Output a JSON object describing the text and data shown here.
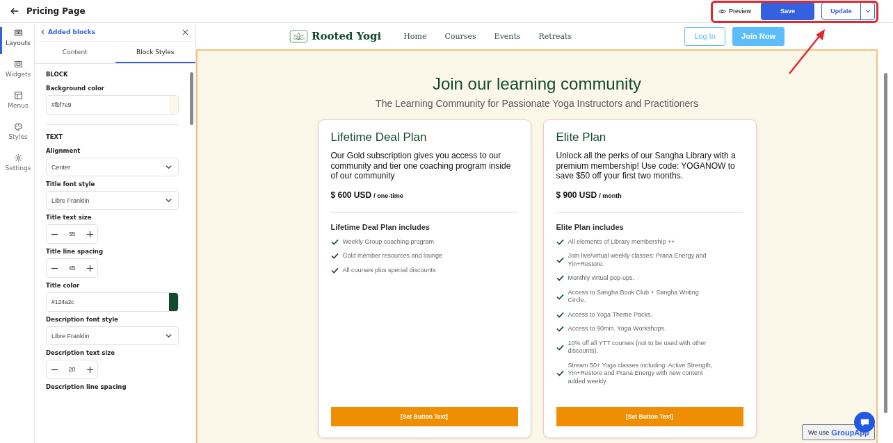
{
  "header": {
    "title": "Pricing Page",
    "preview": "Preview",
    "save": "Save",
    "update": "Update"
  },
  "rail": [
    {
      "label": "Layouts",
      "kind": "layouts",
      "selected": true
    },
    {
      "label": "Widgets",
      "kind": "widgets",
      "selected": false
    },
    {
      "label": "Menus",
      "kind": "menus",
      "selected": false
    },
    {
      "label": "Styles",
      "kind": "styles",
      "selected": false
    },
    {
      "label": "Settings",
      "kind": "settings",
      "selected": false
    }
  ],
  "panel": {
    "back": "Added blocks",
    "tabs": [
      {
        "label": "Content",
        "selected": false
      },
      {
        "label": "Block Styles",
        "selected": true
      }
    ],
    "sections": [
      {
        "title": "BLOCK",
        "fields": [
          {
            "kind": "color",
            "label": "Background color",
            "value": "#fbf7e9",
            "color": "#fbf7e9"
          }
        ]
      },
      {
        "title": "TEXT",
        "fields": [
          {
            "kind": "select",
            "label": "Alignment",
            "value": "Center"
          },
          {
            "kind": "select",
            "label": "Title font style",
            "value": "Libre Franklin"
          },
          {
            "kind": "stepper",
            "label": "Title text size",
            "value": "35"
          },
          {
            "kind": "stepper",
            "label": "Title line spacing",
            "value": "45"
          },
          {
            "kind": "color",
            "label": "Title color",
            "value": "#124a2c",
            "color": "#124a2c"
          },
          {
            "kind": "select",
            "label": "Description font style",
            "value": "Libre Franklin"
          },
          {
            "kind": "stepper",
            "label": "Description text size",
            "value": "20"
          },
          {
            "kind": "label",
            "label": "Description line spacing"
          }
        ]
      }
    ]
  },
  "site": {
    "logo": "Rooted Yogi",
    "nav": [
      "Home",
      "Courses",
      "Events",
      "Retreats"
    ],
    "login": "Log In",
    "join": "Join Now"
  },
  "hero": {
    "title": "Join our learning community",
    "subtitle": "The Learning Community for Passionate Yoga Instructors and Practitioners"
  },
  "plans": [
    {
      "title": "Lifetime Deal Plan",
      "description": "Our Gold subscription gives you access to our community and tier one coaching program inside of our community",
      "price": "$ 600 USD",
      "period": "/ one-time",
      "includes_title": "Lifetime Deal Plan includes",
      "features": [
        "Weekly Group coaching program",
        "Gold member resources and lounge",
        "All courses plus special discounts"
      ],
      "button": "[Set Button Text]"
    },
    {
      "title": "Elite Plan",
      "description": "Unlock all the perks of our Sangha Library with a premium membership! Use code: YOGANOW to save $50 off your first two months.",
      "price": "$ 900 USD",
      "period": "/ month",
      "includes_title": "Elite Plan includes",
      "features": [
        "All elements of Library membership ++",
        "Join live/virtual weekly classes: Prana Energy and Yin+Restore.",
        "Monthly virtual pop-ups.",
        "Access to Sangha Book Club + Sangha Writing Circle.",
        "Access to Yoga Theme Packs.",
        "Access to 90min. Yoga Workshops.",
        "10% off all YTT courses (not to be used with other discounts).",
        "Stream 50+ Yoga classes including: Active Strength, Yin+Restore and Prana Energy with new content added weekly."
      ],
      "button": "[Set Button Text]"
    }
  ],
  "badge": {
    "prefix": "We use",
    "brand": "GroupApp"
  }
}
